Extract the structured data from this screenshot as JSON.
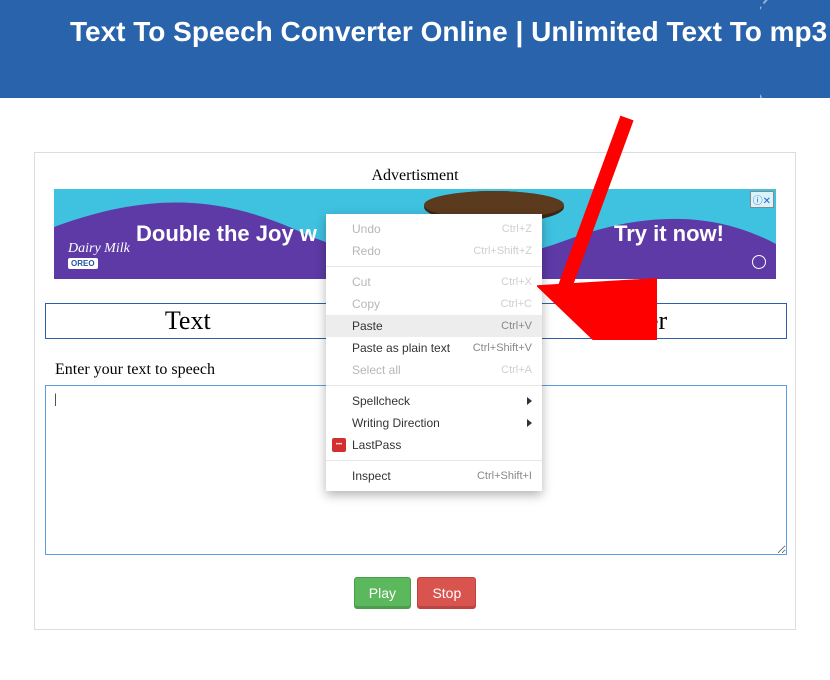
{
  "header": {
    "title": "Text To Speech Converter Online | Unlimited Text To mp3"
  },
  "ad": {
    "label": "Advertisment",
    "left_text": "Double the Joy w",
    "right_text": "Try it now!",
    "brand_top": "Dairy Milk",
    "brand_bottom": "OREO",
    "close": "✕"
  },
  "main": {
    "title": "Text",
    "title_suffix": "ter",
    "input_label": "Enter your text to speech",
    "textarea_value": "|"
  },
  "buttons": {
    "play": "Play",
    "stop": "Stop"
  },
  "context_menu": {
    "items": [
      {
        "id": "undo",
        "label": "Undo",
        "shortcut": "Ctrl+Z",
        "disabled": true
      },
      {
        "id": "redo",
        "label": "Redo",
        "shortcut": "Ctrl+Shift+Z",
        "disabled": true
      },
      {
        "sep": true
      },
      {
        "id": "cut",
        "label": "Cut",
        "shortcut": "Ctrl+X",
        "disabled": true
      },
      {
        "id": "copy",
        "label": "Copy",
        "shortcut": "Ctrl+C",
        "disabled": true
      },
      {
        "id": "paste",
        "label": "Paste",
        "shortcut": "Ctrl+V",
        "highlight": true
      },
      {
        "id": "paste-plain",
        "label": "Paste as plain text",
        "shortcut": "Ctrl+Shift+V"
      },
      {
        "id": "select-all",
        "label": "Select all",
        "shortcut": "Ctrl+A",
        "disabled": true
      },
      {
        "sep": true
      },
      {
        "id": "spellcheck",
        "label": "Spellcheck",
        "submenu": true
      },
      {
        "id": "writing-direction",
        "label": "Writing Direction",
        "submenu": true
      },
      {
        "id": "lastpass",
        "label": "LastPass",
        "icon": "lastpass"
      },
      {
        "sep": true
      },
      {
        "id": "inspect",
        "label": "Inspect",
        "shortcut": "Ctrl+Shift+I"
      }
    ]
  }
}
